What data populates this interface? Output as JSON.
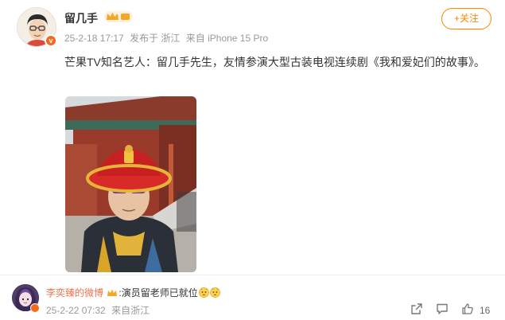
{
  "post": {
    "username": "留几手",
    "date": "25-2-18 17:17",
    "source": "发布于 浙江",
    "device": "来自 iPhone 15 Pro",
    "follow_label": "+关注",
    "text": "芒果TV知名艺人：留几手先生，友情参演大型古装电视连续剧《我和爱妃们的故事》。"
  },
  "comment": {
    "username": "李奕臻的微博",
    "separator": ":",
    "text": "演员留老师已就位",
    "date": "25-2-22 07:32",
    "source": "来自浙江",
    "likes": "16"
  },
  "colors": {
    "accent": "#ff8200",
    "comment_user": "#eb7350",
    "meta": "#999999"
  }
}
